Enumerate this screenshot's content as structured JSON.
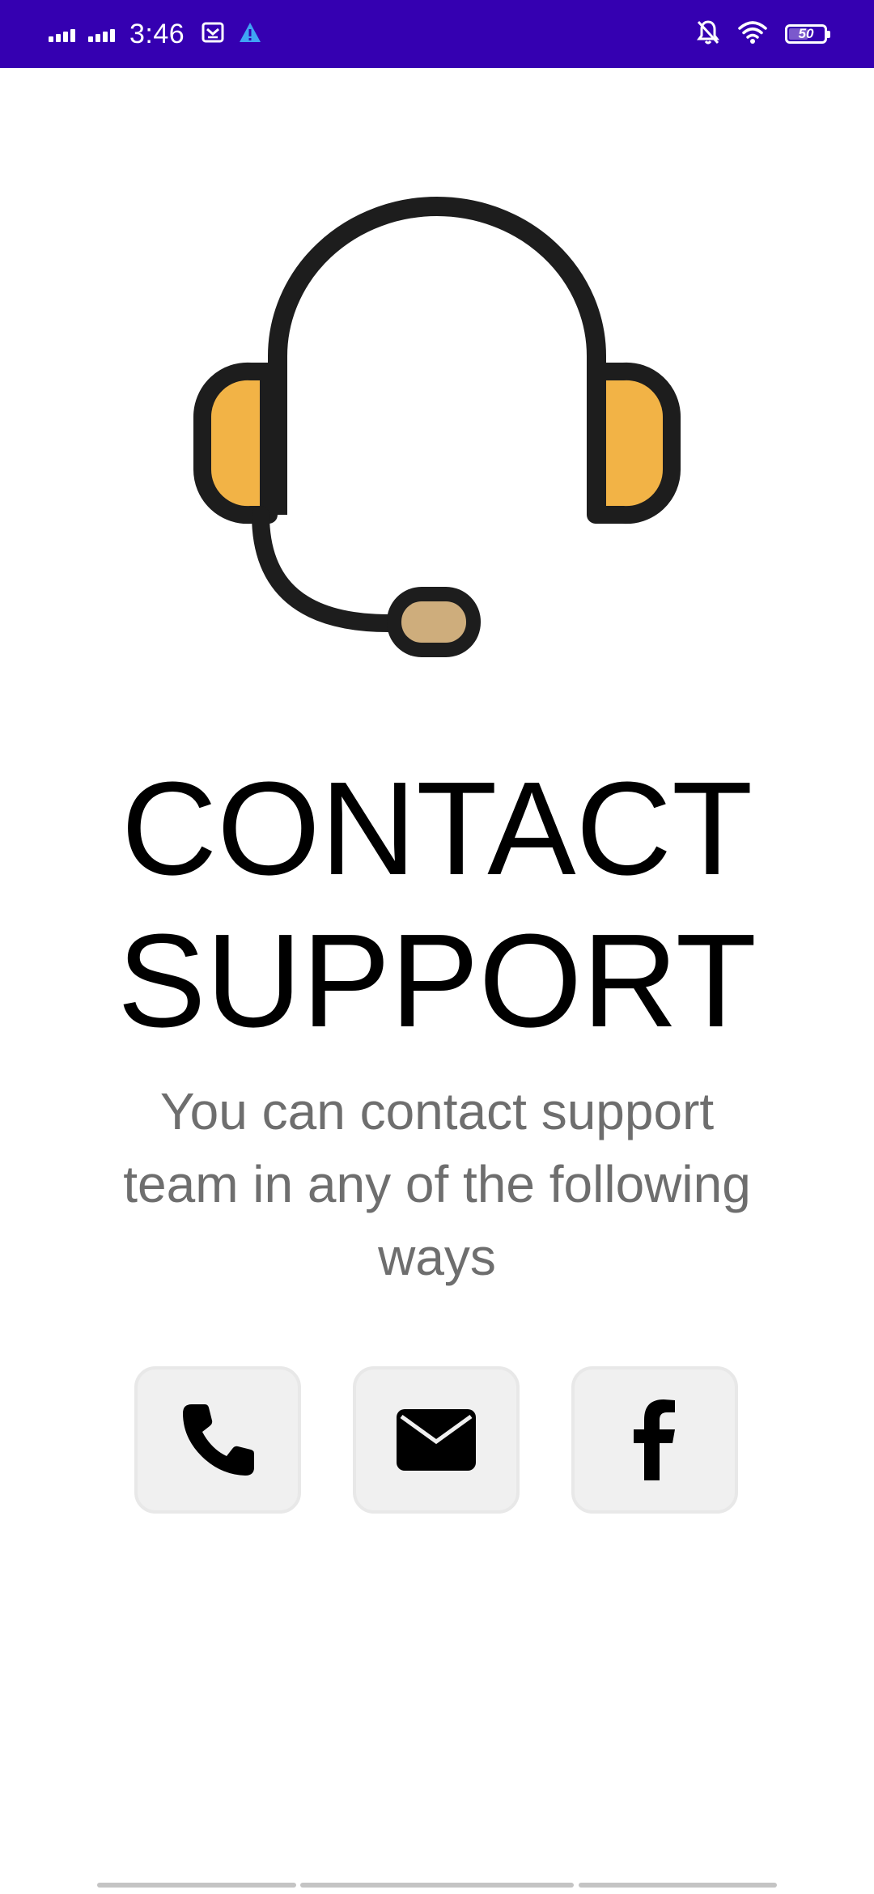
{
  "status_bar": {
    "time": "3:46",
    "battery": "50",
    "background": "#3500b1",
    "icons": [
      "signal-icon",
      "signal-icon",
      "mail-icon",
      "warning-icon",
      "notifications-off-icon",
      "wifi-icon",
      "battery-icon"
    ]
  },
  "hero": {
    "icon": "headset-icon",
    "colors": {
      "outline": "#1d1d1d",
      "ear_cups": "#f2b346",
      "mic": "#cead7c"
    }
  },
  "title": {
    "line1": "CONTACT",
    "line2": "SUPPORT"
  },
  "subtitle": {
    "line1": "You can contact support",
    "line2": "team in any of the following",
    "line3": "ways"
  },
  "contact_options": [
    {
      "icon": "phone-icon"
    },
    {
      "icon": "mail-icon"
    },
    {
      "icon": "facebook-icon"
    }
  ],
  "nav_bar": {
    "color": "#c4c4c4"
  }
}
